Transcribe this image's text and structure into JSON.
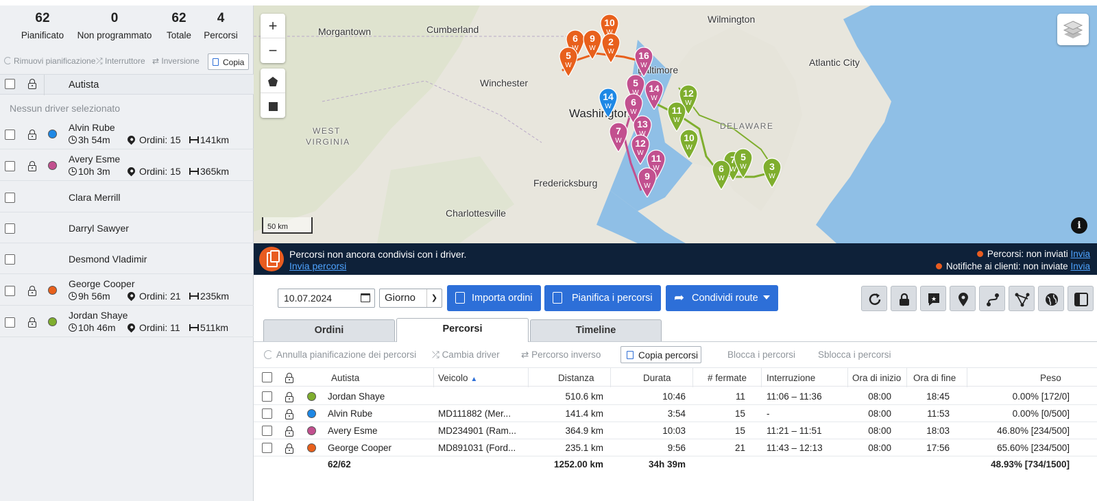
{
  "stats": [
    {
      "value": "62",
      "label": "Pianificato"
    },
    {
      "value": "0",
      "label": "Non programmato"
    },
    {
      "value": "62",
      "label": "Totale"
    },
    {
      "value": "4",
      "label": "Percorsi"
    }
  ],
  "left_toolbar": {
    "remove": "Rimuovi pianificazione",
    "switch": "Interruttore",
    "invert": "Inversione",
    "copy": "Copia"
  },
  "driver_header": "Autista",
  "no_driver": "Nessun driver selezionato",
  "drivers": [
    {
      "name": "Alvin Rube",
      "time": "3h 54m",
      "orders": "Ordini: 15",
      "dist": "141km",
      "color": "#1e88e5"
    },
    {
      "name": "Avery Esme",
      "time": "10h 3m",
      "orders": "Ordini: 15",
      "dist": "365km",
      "color": "#c2508f"
    },
    {
      "name": "Clara Merrill"
    },
    {
      "name": "Darryl Sawyer"
    },
    {
      "name": "Desmond Vladimir"
    },
    {
      "name": "George Cooper",
      "time": "9h 56m",
      "orders": "Ordini: 21",
      "dist": "235km",
      "color": "#e8601c"
    },
    {
      "name": "Jordan Shaye",
      "time": "10h 46m",
      "orders": "Ordini: 11",
      "dist": "511km",
      "color": "#7fae2e"
    }
  ],
  "map": {
    "labels": {
      "wilmington": "Wilmington",
      "morgantown": "Morgantown",
      "cumberland": "Cumberland",
      "atlantic_city": "Atlantic City",
      "winchester": "Winchester",
      "washington": "Washington",
      "baltimore": "Baltimore",
      "west_virginia_1": "WEST",
      "west_virginia_2": "VIRGINIA",
      "delaware": "DELAWARE",
      "fredericksburg": "Fredericksburg",
      "charlottesville": "Charlottesville"
    },
    "scale": "50 km",
    "zoom_in": "+",
    "zoom_out": "−",
    "info": "i",
    "w_label": "W",
    "pins": [
      {
        "n": "10",
        "route": "orange"
      },
      {
        "n": "6",
        "route": "orange"
      },
      {
        "n": "9",
        "route": "orange"
      },
      {
        "n": "2",
        "route": "orange"
      },
      {
        "n": "5",
        "route": "orange"
      },
      {
        "n": "16",
        "route": "pink"
      },
      {
        "n": "5",
        "route": "pink"
      },
      {
        "n": "14",
        "route": "pink"
      },
      {
        "n": "6",
        "route": "pink"
      },
      {
        "n": "13",
        "route": "pink"
      },
      {
        "n": "7",
        "route": "pink"
      },
      {
        "n": "12",
        "route": "pink"
      },
      {
        "n": "11",
        "route": "pink"
      },
      {
        "n": "9",
        "route": "pink"
      },
      {
        "n": "14",
        "route": "blue"
      },
      {
        "n": "12",
        "route": "green"
      },
      {
        "n": "11",
        "route": "green"
      },
      {
        "n": "10",
        "route": "green"
      },
      {
        "n": "7",
        "route": "green"
      },
      {
        "n": "5",
        "route": "green"
      },
      {
        "n": "6",
        "route": "green"
      },
      {
        "n": "3",
        "route": "green"
      }
    ]
  },
  "notification": {
    "message": "Percorsi non ancora condivisi con i driver.",
    "link": "Invia percorsi",
    "status1": "Percorsi: non inviati",
    "status2": "Notifiche ai clienti: non inviate",
    "send": "Invia"
  },
  "toolbar": {
    "date": "10.07.2024",
    "period": "Giorno",
    "import": "Importa ordini",
    "plan": "Pianifica i percorsi",
    "share": "Condividi route"
  },
  "tabs": [
    "Ordini",
    "Percorsi",
    "Timeline"
  ],
  "routes_toolbar": {
    "cancel": "Annulla pianificazione dei percorsi",
    "change": "Cambia driver",
    "reverse": "Percorso inverso",
    "copy": "Copia percorsi",
    "lock": "Blocca i percorsi",
    "unlock": "Sblocca i percorsi"
  },
  "table": {
    "headers": {
      "driver": "Autista",
      "vehicle": "Veicolo",
      "distance": "Distanza",
      "duration": "Durata",
      "stops": "# fermate",
      "break": "Interruzione",
      "start": "Ora di inizio",
      "end": "Ora di fine",
      "weight": "Peso"
    },
    "rows": [
      {
        "driver": "Jordan Shaye",
        "vehicle": "",
        "distance": "510.6 km",
        "duration": "10:46",
        "stops": "11",
        "break": "11:06 – 11:36",
        "start": "08:00",
        "end": "18:45",
        "weight": "0.00% [172/0]",
        "color": "#7fae2e"
      },
      {
        "driver": "Alvin Rube",
        "vehicle": "MD111882 (Mer...",
        "distance": "141.4 km",
        "duration": "3:54",
        "stops": "15",
        "break": "-",
        "start": "08:00",
        "end": "11:53",
        "weight": "0.00% [0/500]",
        "color": "#1e88e5"
      },
      {
        "driver": "Avery Esme",
        "vehicle": "MD234901 (Ram...",
        "distance": "364.9 km",
        "duration": "10:03",
        "stops": "15",
        "break": "11:21 – 11:51",
        "start": "08:00",
        "end": "18:03",
        "weight": "46.80% [234/500]",
        "color": "#c2508f"
      },
      {
        "driver": "George Cooper",
        "vehicle": "MD891031 (Ford...",
        "distance": "235.1 km",
        "duration": "9:56",
        "stops": "21",
        "break": "11:43 – 12:13",
        "start": "08:00",
        "end": "17:56",
        "weight": "65.60% [234/500]",
        "color": "#e8601c"
      }
    ],
    "totals": {
      "count": "62/62",
      "distance": "1252.00 km",
      "duration": "34h 39m",
      "weight": "48.93% [734/1500]"
    }
  }
}
